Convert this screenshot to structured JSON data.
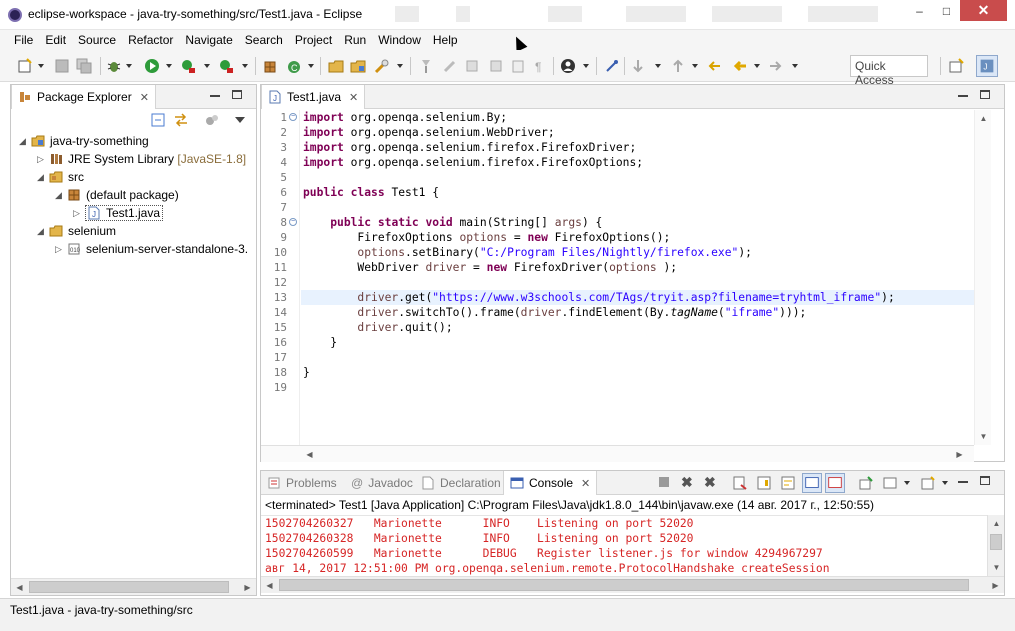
{
  "window": {
    "title": "eclipse-workspace - java-try-something/src/Test1.java - Eclipse",
    "controls": {
      "minimize": "–",
      "maximize": "□",
      "close": "✕"
    }
  },
  "menu": [
    "File",
    "Edit",
    "Source",
    "Refactor",
    "Navigate",
    "Search",
    "Project",
    "Run",
    "Window",
    "Help"
  ],
  "toolbar": {
    "quick_access": "Quick Access"
  },
  "package_explorer": {
    "tab_label": "Package Explorer",
    "tree": [
      {
        "label": "java-try-something",
        "suffix": ""
      },
      {
        "label": "JRE System Library",
        "suffix": "[JavaSE-1.8]"
      },
      {
        "label": "src",
        "suffix": ""
      },
      {
        "label": "(default package)",
        "suffix": ""
      },
      {
        "label": "Test1.java",
        "suffix": ""
      },
      {
        "label": "selenium",
        "suffix": ""
      },
      {
        "label": "selenium-server-standalone-3.",
        "suffix": ""
      }
    ]
  },
  "editor": {
    "tab_label": "Test1.java",
    "line_numbers": [
      "1",
      "2",
      "3",
      "4",
      "5",
      "6",
      "7",
      "8",
      "9",
      "10",
      "11",
      "12",
      "13",
      "14",
      "15",
      "16",
      "17",
      "18",
      "19"
    ],
    "code": {
      "l1_kw": "import",
      "l1_rest": " org.openqa.selenium.By;",
      "l2_kw": "import",
      "l2_rest": " org.openqa.selenium.WebDriver;",
      "l3_kw": "import",
      "l3_rest": " org.openqa.selenium.firefox.FirefoxDriver;",
      "l4_kw": "import",
      "l4_rest": " org.openqa.selenium.firefox.FirefoxOptions;",
      "l6_kw1": "public",
      "l6_kw2": "class",
      "l6_rest": " Test1 {",
      "l8_kw1": "public",
      "l8_kw2": "static",
      "l8_kw3": "void",
      "l8_rest": " main(String[] ",
      "l8_var": "args",
      "l8_end": ") {",
      "l9_a": "FirefoxOptions ",
      "l9_var": "options",
      "l9_b": " = ",
      "l9_kw": "new",
      "l9_c": " FirefoxOptions();",
      "l10_var": "options",
      "l10_a": ".setBinary(",
      "l10_str": "\"C:/Program Files/Nightly/firefox.exe\"",
      "l10_b": ");",
      "l11_a": "WebDriver ",
      "l11_var": "driver",
      "l11_b": " = ",
      "l11_kw": "new",
      "l11_c": " FirefoxDriver(",
      "l11_var2": "options",
      "l11_d": " );",
      "l13_var": "driver",
      "l13_a": ".get(",
      "l13_str": "\"https://www.w3schools.com/TAgs/tryit.asp?filename=tryhtml_iframe\"",
      "l13_b": ");",
      "l14_var": "driver",
      "l14_a": ".switchTo().frame(",
      "l14_var2": "driver",
      "l14_b": ".findElement(By.",
      "l14_it": "tagName",
      "l14_c": "(",
      "l14_str": "\"iframe\"",
      "l14_d": ")));",
      "l15_var": "driver",
      "l15_a": ".quit();",
      "l16": "}",
      "l18": "}"
    }
  },
  "bottom_panel": {
    "tabs": [
      "Problems",
      "Javadoc",
      "Declaration",
      "Console"
    ],
    "console_header": "<terminated> Test1 [Java Application] C:\\Program Files\\Java\\jdk1.8.0_144\\bin\\javaw.exe (14 авг. 2017 г., 12:50:55)",
    "lines": [
      "1502704260327   Marionette      INFO    Listening on port 52020",
      "1502704260328   Marionette      INFO    Listening on port 52020",
      "1502704260599   Marionette      DEBUG   Register listener.js for window 4294967297",
      "авг 14, 2017 12:51:00 PM org.openqa.selenium.remote.ProtocolHandshake createSession"
    ]
  },
  "status_bar": {
    "text": "Test1.java - java-try-something/src"
  },
  "colors": {
    "keyword": "#7f0055",
    "string": "#2a00ff",
    "console_text": "#d62525",
    "current_line": "#e8f2fe"
  }
}
